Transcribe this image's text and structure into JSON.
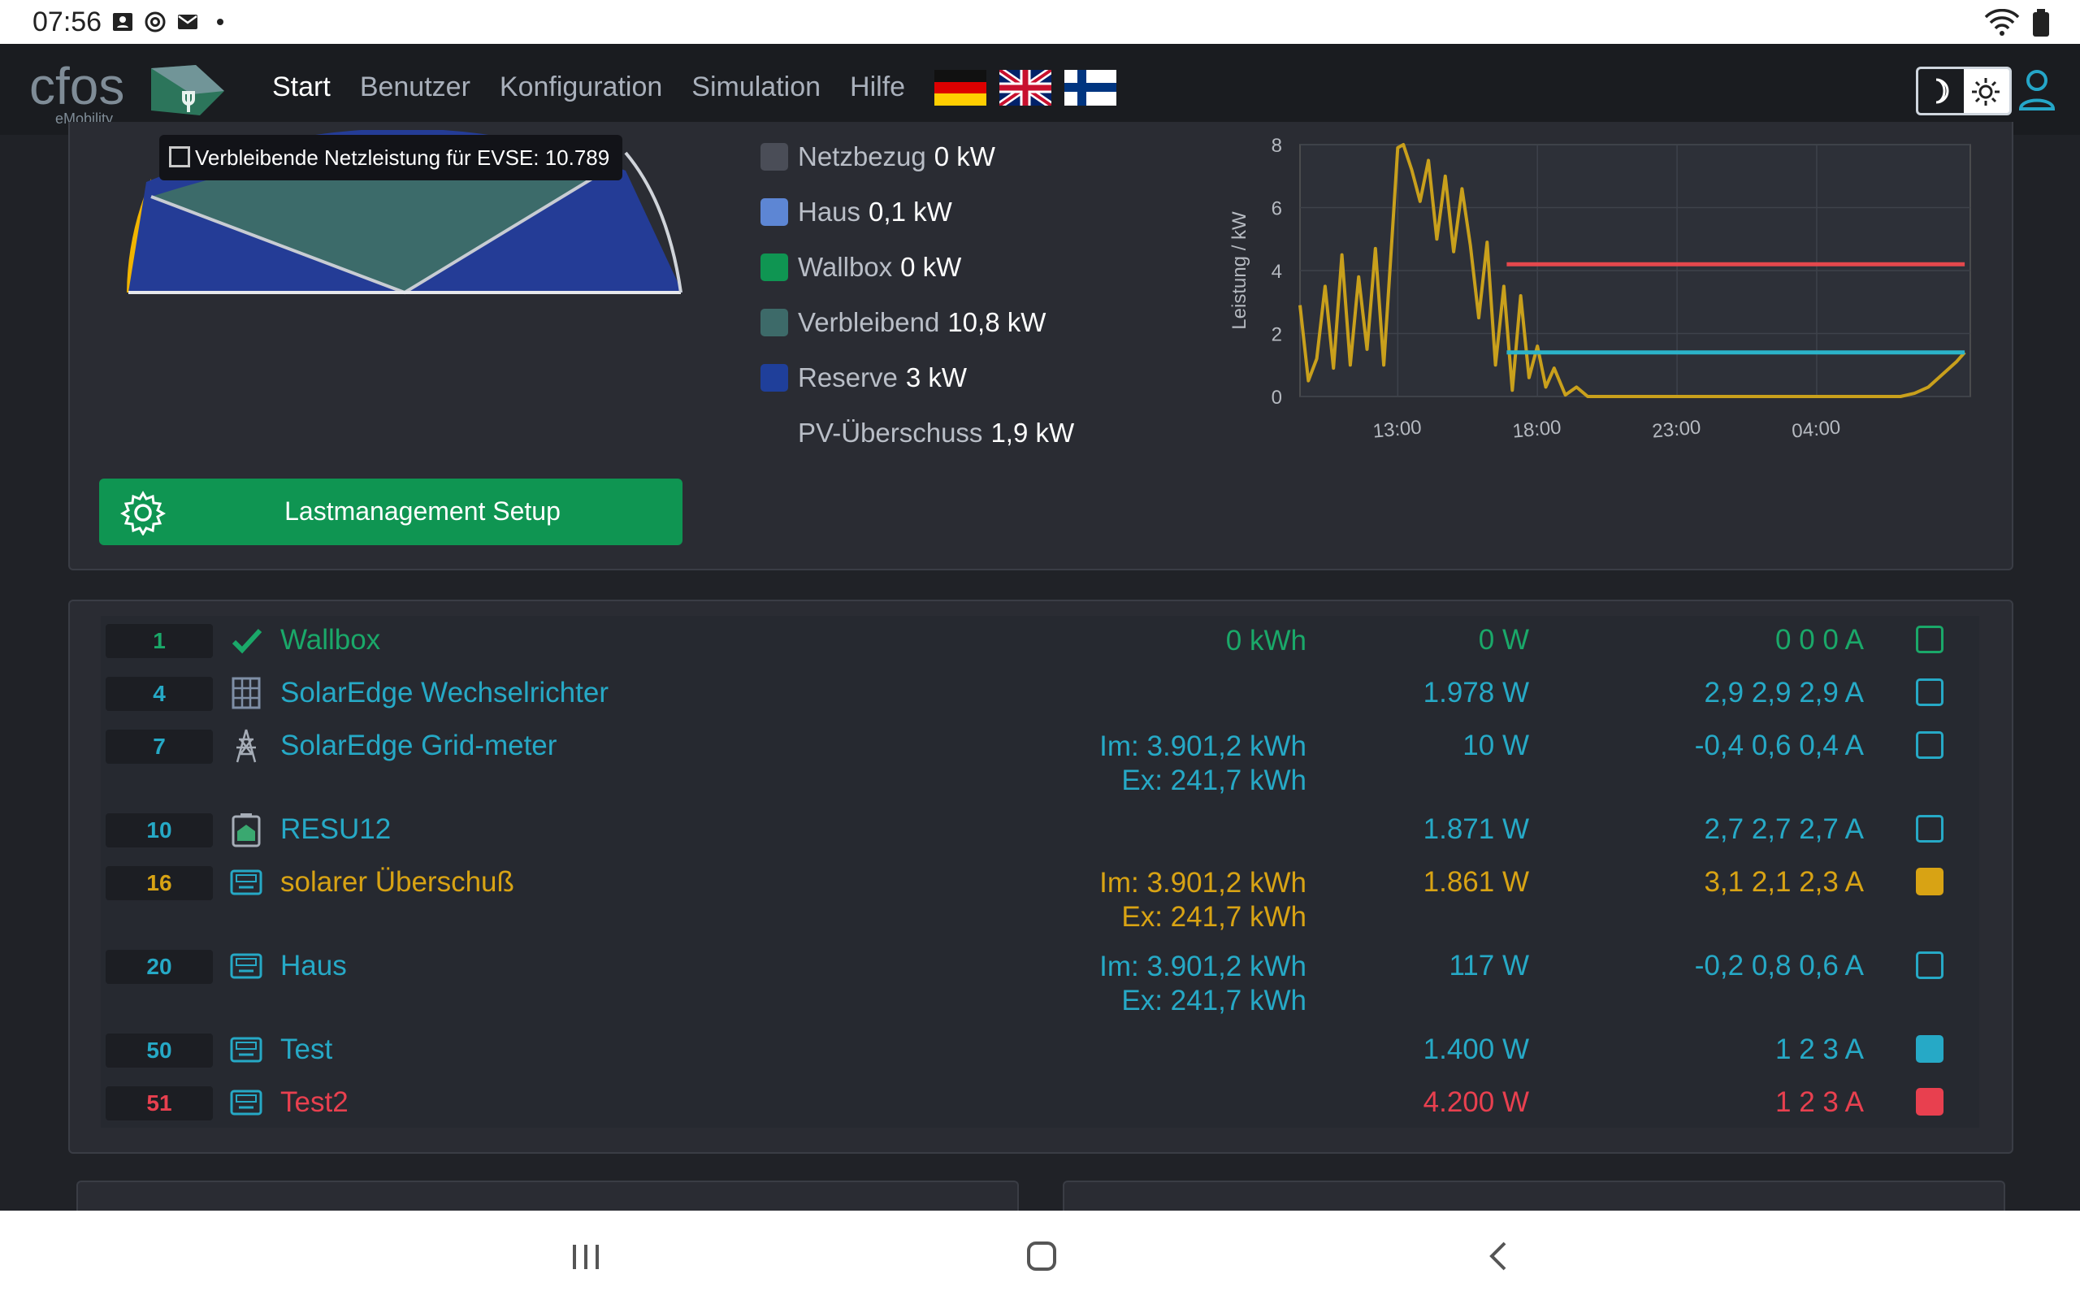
{
  "status_bar": {
    "time": "07:56",
    "icons": [
      "contact-icon",
      "at-icon",
      "mail-icon",
      "dot-icon"
    ],
    "right_icons": [
      "wifi-icon",
      "battery-icon"
    ]
  },
  "header": {
    "logo_text": "cfos",
    "logo_subtext": "eMobility",
    "nav": [
      "Start",
      "Benutzer",
      "Konfiguration",
      "Simulation",
      "Hilfe"
    ],
    "active_nav": "Start",
    "flags": [
      "flag-de-icon",
      "flag-uk-icon",
      "flag-fi-icon"
    ]
  },
  "overview": {
    "tooltip": "Verbleibende Netzleistung für EVSE: 10.789",
    "legend": [
      {
        "label": "Netzbezug",
        "value": "0 kW",
        "color": "#4a4d57"
      },
      {
        "label": "Haus",
        "value": "0,1 kW",
        "color": "#5d86d4"
      },
      {
        "label": "Wallbox",
        "value": "0 kW",
        "color": "#0f9552"
      },
      {
        "label": "Verbleibend",
        "value": "10,8 kW",
        "color": "#3d6a69"
      },
      {
        "label": "Reserve",
        "value": "3 kW",
        "color": "#1f3f9a"
      },
      {
        "label": "PV-Überschuss",
        "value": "1,9 kW",
        "color": ""
      }
    ],
    "button_label": "Lastmanagement Setup"
  },
  "chart_data": {
    "type": "line",
    "title": "",
    "xlabel": "",
    "ylabel": "Leistung / kW",
    "x_ticks": [
      "13:00",
      "18:00",
      "23:00",
      "04:00"
    ],
    "y_ticks": [
      0,
      2,
      4,
      6,
      8
    ],
    "ylim": [
      0,
      8
    ],
    "xlim": [
      9.5,
      33.5
    ],
    "grid": true,
    "series": [
      {
        "color": "#c9a01c",
        "x": [
          9.5,
          9.8,
          10.1,
          10.4,
          10.7,
          11.0,
          11.3,
          11.6,
          11.9,
          12.2,
          12.5,
          12.8,
          13.0,
          13.2,
          13.5,
          13.8,
          14.1,
          14.4,
          14.7,
          15.0,
          15.3,
          15.6,
          15.9,
          16.2,
          16.5,
          16.8,
          17.1,
          17.4,
          17.7,
          18.0,
          18.3,
          18.6,
          19.0,
          19.4,
          19.8,
          20.5,
          21.5,
          23.0,
          25.0,
          27.0,
          29.0,
          30.5,
          31.0,
          31.5,
          32.0,
          32.5,
          33.0,
          33.3
        ],
        "y": [
          2.9,
          0.5,
          1.2,
          3.5,
          0.9,
          4.5,
          1.0,
          3.8,
          1.5,
          4.7,
          1.0,
          5.1,
          7.9,
          8.0,
          7.2,
          6.2,
          7.5,
          5.0,
          7.0,
          4.6,
          6.6,
          4.8,
          2.5,
          4.9,
          1.0,
          3.5,
          0.2,
          3.2,
          0.6,
          1.6,
          0.3,
          0.9,
          0.05,
          0.3,
          0.0,
          0.0,
          0.0,
          0.0,
          0.0,
          0.0,
          0.0,
          0.0,
          0.0,
          0.1,
          0.3,
          0.7,
          1.1,
          1.4
        ]
      },
      {
        "color": "#e5484d",
        "x": [
          16.9,
          33.3
        ],
        "y": [
          4.2,
          4.2
        ]
      },
      {
        "color": "#2bb3c9",
        "x": [
          16.9,
          33.3
        ],
        "y": [
          1.4,
          1.4
        ]
      }
    ]
  },
  "devices": [
    {
      "id": "1",
      "icon": "check-icon",
      "name": "Wallbox",
      "kwh": [
        "0 kWh"
      ],
      "watt": "0 W",
      "amps": "0 0 0 A",
      "color": "green",
      "checkbox": "outline"
    },
    {
      "id": "4",
      "icon": "solar-panel-icon",
      "name": "SolarEdge Wechselrichter",
      "kwh": [],
      "watt": "1.978 W",
      "amps": "2,9 2,9 2,9 A",
      "color": "blue",
      "checkbox": "outline"
    },
    {
      "id": "7",
      "icon": "power-pylon-icon",
      "name": "SolarEdge Grid-meter",
      "kwh": [
        "Im: 3.901,2 kWh",
        "Ex: 241,7 kWh"
      ],
      "watt": "10 W",
      "amps": "-0,4 0,6 0,4 A",
      "color": "blue",
      "checkbox": "outline"
    },
    {
      "id": "10",
      "icon": "battery-storage-icon",
      "name": "RESU12",
      "kwh": [],
      "watt": "1.871 W",
      "amps": "2,7 2,7 2,7 A",
      "color": "blue",
      "checkbox": "outline"
    },
    {
      "id": "16",
      "icon": "meter-icon",
      "name": "solarer Überschuß",
      "kwh": [
        "Im: 3.901,2 kWh",
        "Ex: 241,7 kWh"
      ],
      "watt": "1.861 W",
      "amps": "3,1 2,1 2,3 A",
      "color": "gold",
      "checkbox": "filled"
    },
    {
      "id": "20",
      "icon": "meter-icon",
      "name": "Haus",
      "kwh": [
        "Im: 3.901,2 kWh",
        "Ex: 241,7 kWh"
      ],
      "watt": "117 W",
      "amps": "-0,2 0,8 0,6 A",
      "color": "blue",
      "checkbox": "outline"
    },
    {
      "id": "50",
      "icon": "meter-icon",
      "name": "Test",
      "kwh": [],
      "watt": "1.400 W",
      "amps": "1 2 3 A",
      "color": "blue",
      "checkbox": "filled"
    },
    {
      "id": "51",
      "icon": "meter-icon",
      "name": "Test2",
      "kwh": [],
      "watt": "4.200 W",
      "amps": "1 2 3 A",
      "color": "red",
      "checkbox": "filled"
    }
  ],
  "nav_bar": [
    "recent-apps-icon",
    "home-icon",
    "back-icon"
  ]
}
